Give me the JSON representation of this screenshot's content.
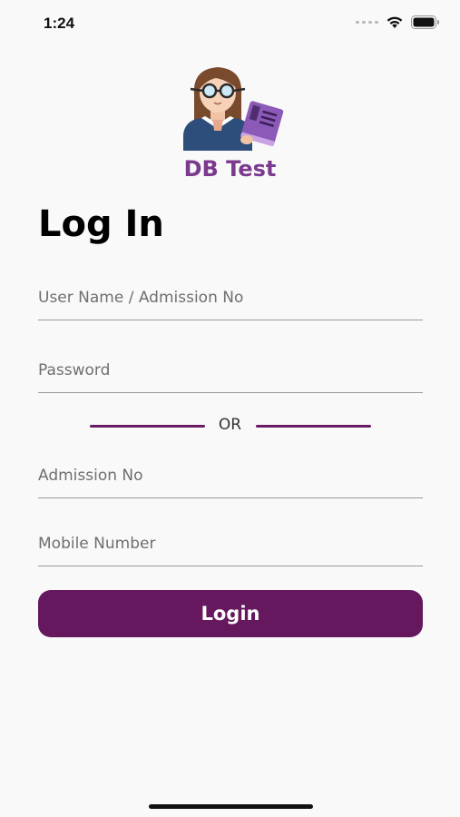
{
  "status_bar": {
    "time": "1:24"
  },
  "app": {
    "name": "DB Test"
  },
  "page": {
    "title": "Log In"
  },
  "form": {
    "username_placeholder": "User Name / Admission No",
    "password_placeholder": "Password",
    "separator_text": "OR",
    "admission_placeholder": "Admission No",
    "mobile_placeholder": "Mobile Number",
    "login_label": "Login"
  },
  "colors": {
    "brand": "#65185e",
    "app_name": "#7b3a8e"
  }
}
